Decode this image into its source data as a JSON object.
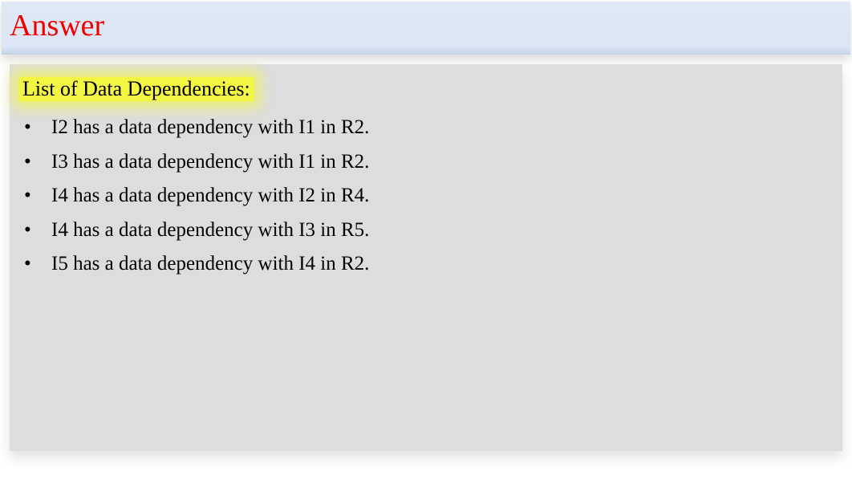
{
  "title": "Answer",
  "heading": "List of Data Dependencies:",
  "items": [
    "I2 has a data dependency with I1 in R2.",
    "I3 has a data dependency with I1 in R2.",
    "I4 has a data dependency with I2 in R4.",
    "I4 has a data dependency with I3 in R5.",
    "I5 has a data dependency with I4 in R2."
  ]
}
